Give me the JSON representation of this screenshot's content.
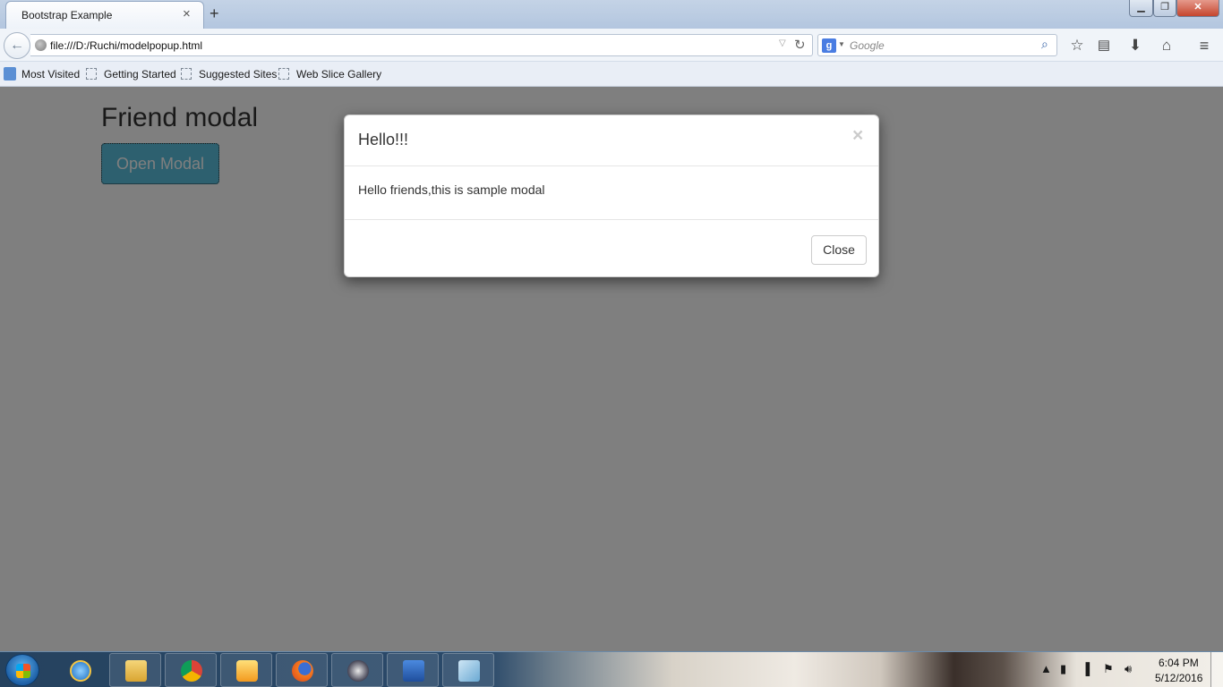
{
  "browser": {
    "tab_title": "Bootstrap Example",
    "tab_close": "×",
    "new_tab": "+",
    "window_controls": {
      "minimize": "▁",
      "maximize": "❐",
      "close": "✕"
    },
    "url": "file:///D:/Ruchi/modelpopup.html",
    "search_placeholder": "Google",
    "bookmarks": [
      "Most Visited",
      "Getting Started",
      "Suggested Sites",
      "Web Slice Gallery"
    ],
    "icons": {
      "back": "back-arrow-icon",
      "reload": "reload-icon",
      "bookmark": "star-icon",
      "reading": "clipboard-icon",
      "downloads": "download-icon",
      "home": "home-icon",
      "menu": "hamburger-menu-icon"
    }
  },
  "page": {
    "heading": "Friend modal",
    "open_button": "Open Modal",
    "button_color": "#5bc0de"
  },
  "modal": {
    "title": "Hello!!!",
    "close_x": "×",
    "body": "Hello friends,this is sample modal",
    "close_button": "Close"
  },
  "taskbar": {
    "apps": [
      "internet-explorer-icon",
      "file-explorer-icon",
      "chrome-icon",
      "media-player-icon",
      "firefox-icon",
      "media-center-icon",
      "word-icon",
      "eraser-icon"
    ],
    "time": "6:04 PM",
    "date": "5/12/2016"
  }
}
